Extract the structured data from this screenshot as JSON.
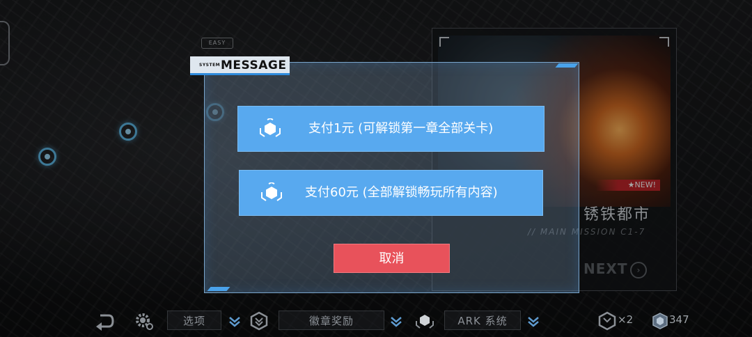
{
  "stage": {
    "difficulty_tag": "EASY"
  },
  "mission_card": {
    "new_badge": "★NEW!",
    "title": "锈铁都市",
    "subtitle": "// MAIN MISSION C1-7",
    "next_label": "NEXT",
    "next_icon": "arrow-right-circle-icon"
  },
  "dialog": {
    "header_small": "SYSTEM",
    "header_title": "MESSAGE",
    "options": [
      {
        "label": "支付1元 (可解锁第一章全部关卡)",
        "icon": "hexagon-gem-icon"
      },
      {
        "label": "支付60元 (全部解锁畅玩所有内容)",
        "icon": "hexagon-gem-icon"
      }
    ],
    "cancel_label": "取消"
  },
  "bottom_bar": {
    "back_icon": "back-arrow-icon",
    "settings_icon": "gear-icon",
    "options_label": "选项",
    "badge_icon": "badge-icon",
    "badge_reward_label": "徽章奖励",
    "ark_icon": "ark-cube-icon",
    "ark_label": "ARK 系统",
    "medal_count": "×2",
    "gem_count": "347"
  },
  "colors": {
    "dialog_button": "#58a9ef",
    "cancel_button": "#e8525b",
    "accent_blue": "#4aa2ea",
    "new_badge": "#c0262a"
  }
}
